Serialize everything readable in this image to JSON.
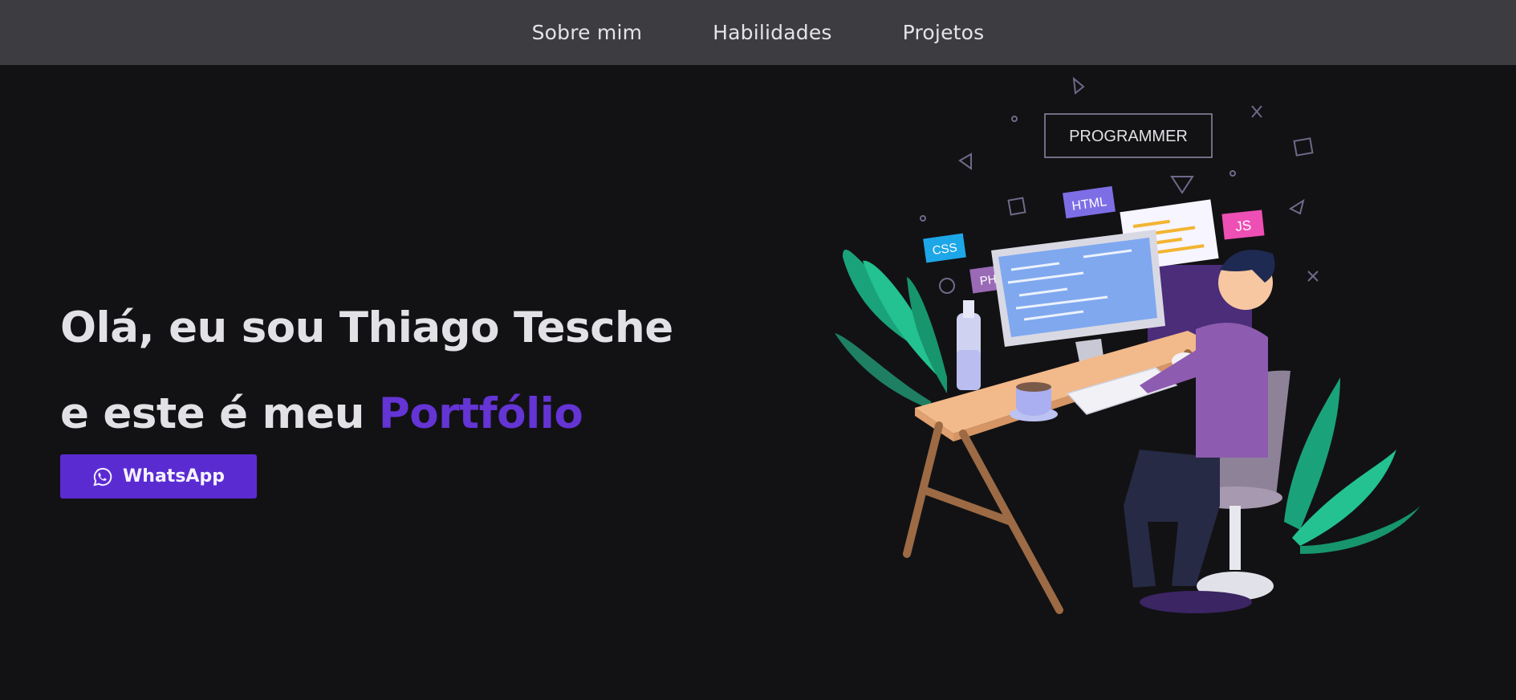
{
  "nav": {
    "items": [
      {
        "label": "Sobre mim"
      },
      {
        "label": "Habilidades"
      },
      {
        "label": "Projetos"
      }
    ]
  },
  "hero": {
    "line1": "Olá, eu sou Thiago Tesche",
    "line2_prefix": "e este é meu ",
    "line2_accent": "Portfólio"
  },
  "cta": {
    "label": "WhatsApp",
    "icon": "whatsapp-icon"
  },
  "illustration": {
    "badge": "PROGRAMMER",
    "tags": {
      "html": "HTML",
      "css": "CSS",
      "php": "PHP",
      "js": "JS"
    }
  },
  "colors": {
    "background": "#121214",
    "navbar": "#3d3c41",
    "accent": "#6434d4",
    "button": "#5b2bd2",
    "text": "#e1e1e6"
  }
}
